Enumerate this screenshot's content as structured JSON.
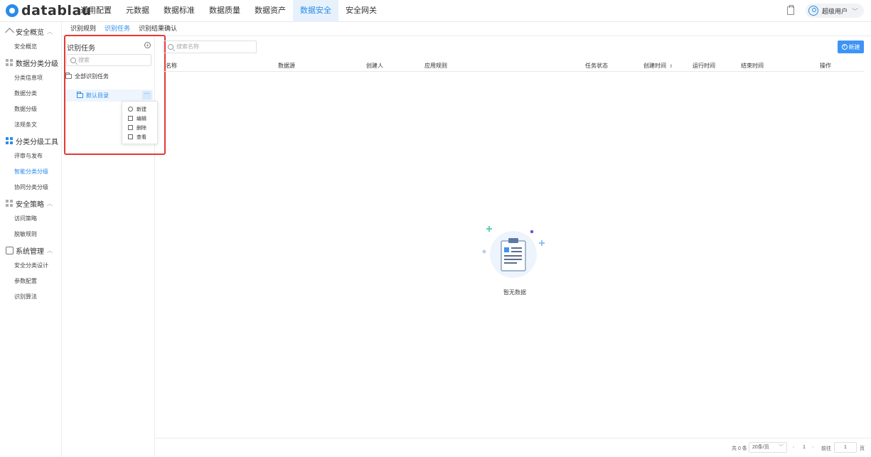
{
  "brand": {
    "name": "datablau",
    "accent": "#2a8ce8"
  },
  "topnav": {
    "items": [
      "通用配置",
      "元数据",
      "数据标准",
      "数据质量",
      "数据资产",
      "数据安全",
      "安全网关"
    ],
    "active_index": 5
  },
  "user": {
    "name": "超级用户"
  },
  "sidebar": {
    "groups": [
      {
        "label": "安全概览",
        "icon": "home-icon",
        "items": [
          "安全概览"
        ]
      },
      {
        "label": "数据分类分级",
        "icon": "grid-icon",
        "items": [
          "分类信息项",
          "数据分类",
          "数据分级",
          "法规条文"
        ]
      },
      {
        "label": "分类分级工具",
        "icon": "grid-icon",
        "items": [
          "评审与发布",
          "智能分类分级",
          "协同分类分级"
        ],
        "active_item": "智能分类分级"
      },
      {
        "label": "安全策略",
        "icon": "grid-icon",
        "items": [
          "访问策略",
          "脱敏规则"
        ]
      },
      {
        "label": "系统管理",
        "icon": "settings-icon",
        "items": [
          "安全分类设计",
          "参数配置",
          "识别算法"
        ]
      }
    ]
  },
  "tabs": {
    "items": [
      "识别规则",
      "识别任务",
      "识别结果确认"
    ],
    "active_index": 1
  },
  "tree": {
    "title": "识别任务",
    "search_placeholder": "搜索",
    "root": "全部识别任务",
    "child": "默认目录",
    "more": "···",
    "menu": [
      "新建",
      "编辑",
      "删除",
      "查看"
    ]
  },
  "main": {
    "search_placeholder": "搜索名称",
    "new_button": "新建",
    "columns": [
      "名称",
      "数据源",
      "创建人",
      "应用规则",
      "任务状态",
      "创建时间",
      "运行时间",
      "结束时间",
      "操作"
    ],
    "empty_text": "暂无数据"
  },
  "pagination": {
    "total": "共 0 条",
    "page_size": "20条/页",
    "prev": "‹",
    "current": "1",
    "next": "›",
    "goto": "前往",
    "goto_value": "1",
    "page_unit": "页"
  }
}
